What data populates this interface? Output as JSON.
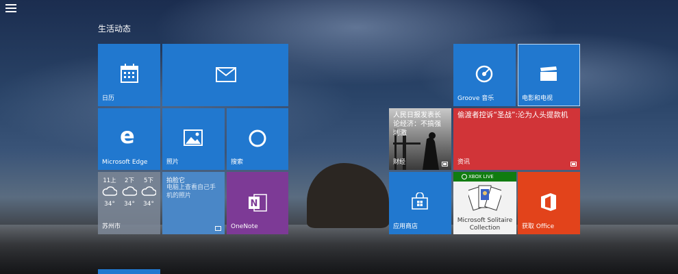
{
  "group": {
    "title": "生活动态"
  },
  "tiles": {
    "calendar": {
      "label": "日历"
    },
    "mail": {
      "label": ""
    },
    "edge": {
      "label": "Microsoft Edge"
    },
    "photos": {
      "label": "照片"
    },
    "search": {
      "label": "搜索"
    },
    "weather": {
      "city": "苏州市",
      "days": [
        {
          "day": "11上",
          "temp": "34°"
        },
        {
          "day": "2下",
          "temp": "34°"
        },
        {
          "day": "5下",
          "temp": "34°"
        }
      ]
    },
    "pailiao": {
      "title": "拍脸它",
      "text": "电脑上查看自己手机的照片"
    },
    "onenote": {
      "label": "OneNote"
    },
    "groove": {
      "label": "Groove 音乐"
    },
    "movies": {
      "label": "电影和电视"
    },
    "finance": {
      "headline": "人民日报发表长论经济：不搞强刺激",
      "label": "财经"
    },
    "news": {
      "headline": "偷渡者控诉“圣战”:沦为人头提款机",
      "label": "资讯"
    },
    "store": {
      "label": "应用商店"
    },
    "solitaire": {
      "badge": "XBOX LIVE",
      "label": "Microsoft Solitaire Collection"
    },
    "office": {
      "label": "获取 Office"
    }
  },
  "colors": {
    "tile_blue": "#2178cf",
    "onenote_purple": "#7d3a96",
    "news_red": "#d13438",
    "office_orange": "#e2431b",
    "xbox_green": "#107c10"
  }
}
